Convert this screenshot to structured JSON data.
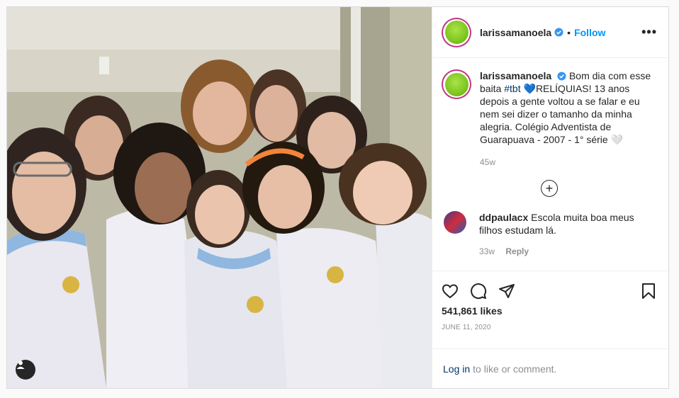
{
  "post": {
    "username": "larissamanoela",
    "follow_label": "Follow",
    "separator": "•",
    "more_label": "•••",
    "caption_prefix": "Bom dia com esse baita ",
    "caption_hashtag": "#tbt",
    "caption_heart": "💙",
    "caption_suffix": "RELÍQUIAS! 13 anos depois a gente voltou a se falar e eu nem sei dizer o tamanho da minha alegria. Colégio Adventista de Guarapuava - 2007 - 1° série 🤍",
    "caption_time": "45w",
    "load_more": "+",
    "likes": "541,861 likes",
    "date": "JUNE 11, 2020"
  },
  "comments": [
    {
      "username": "ddpaulacx",
      "text": "Escola muita boa meus filhos estudam lá.",
      "time": "33w",
      "reply_label": "Reply"
    }
  ],
  "login": {
    "link": "Log in",
    "text": "to like or comment."
  },
  "icons": [
    "heart-icon",
    "comment-icon",
    "share-icon",
    "bookmark-icon",
    "user-tag-icon",
    "verified-badge-icon"
  ],
  "colors": {
    "follow": "#0095f6",
    "hashtag": "#00376b",
    "verified": "#3897f0",
    "border": "#dbdbdb"
  }
}
